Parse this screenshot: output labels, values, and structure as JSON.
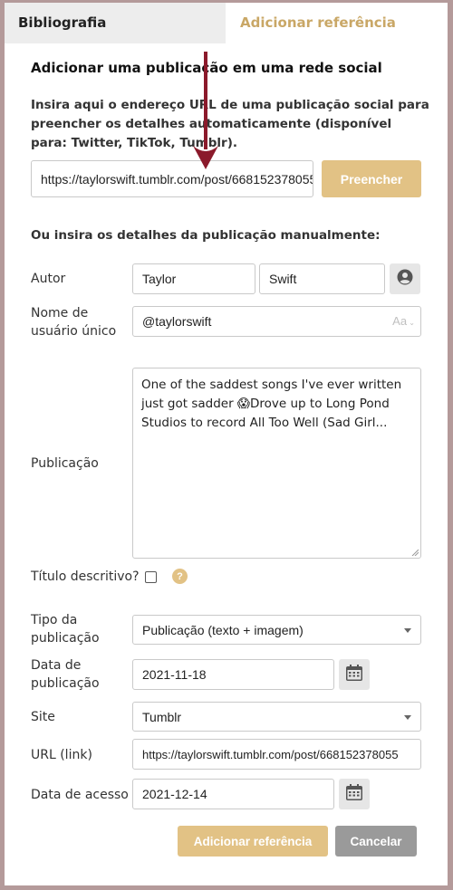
{
  "tabs": {
    "bibliography": "Bibliografia",
    "add_reference": "Adicionar referência"
  },
  "heading": "Adicionar uma publicação em uma rede social",
  "intro": "Insira aqui o endereço URL de uma publicação social para preencher os detalhes automaticamente (disponível para: Twitter, TikTok, Tumblr).",
  "url_fill": {
    "value": "https://taylorswift.tumblr.com/post/668152378055",
    "button": "Preencher"
  },
  "manual_heading": "Ou insira os detalhes da publicação manualmente:",
  "author": {
    "label": "Autor",
    "first_name": "Taylor",
    "last_name": "Swift"
  },
  "username": {
    "label": "Nome de usuário único",
    "value": "@taylorswift",
    "format_hint": "Aa"
  },
  "post": {
    "label": "Publicação",
    "text": "One of the saddest songs I've ever written just got sadder 😱Drove up to Long Pond Studios to record All Too Well (Sad Girl..."
  },
  "descriptive_title": {
    "label": "Título descritivo?",
    "checked": false,
    "help": "?"
  },
  "post_type": {
    "label": "Tipo da publicação",
    "value": "Publicação (texto + imagem)"
  },
  "publication_date": {
    "label": "Data de publicação",
    "value": "2021-11-18"
  },
  "site": {
    "label": "Site",
    "value": "Tumblr"
  },
  "url_link": {
    "label": "URL (link)",
    "value": "https://taylorswift.tumblr.com/post/668152378055"
  },
  "access_date": {
    "label": "Data de acesso",
    "value": "2021-12-14"
  },
  "actions": {
    "add": "Adicionar referência",
    "cancel": "Cancelar"
  },
  "colors": {
    "accent_gold": "#e2c285",
    "arrow": "#8b1a2b",
    "background": "#b49a9a"
  }
}
